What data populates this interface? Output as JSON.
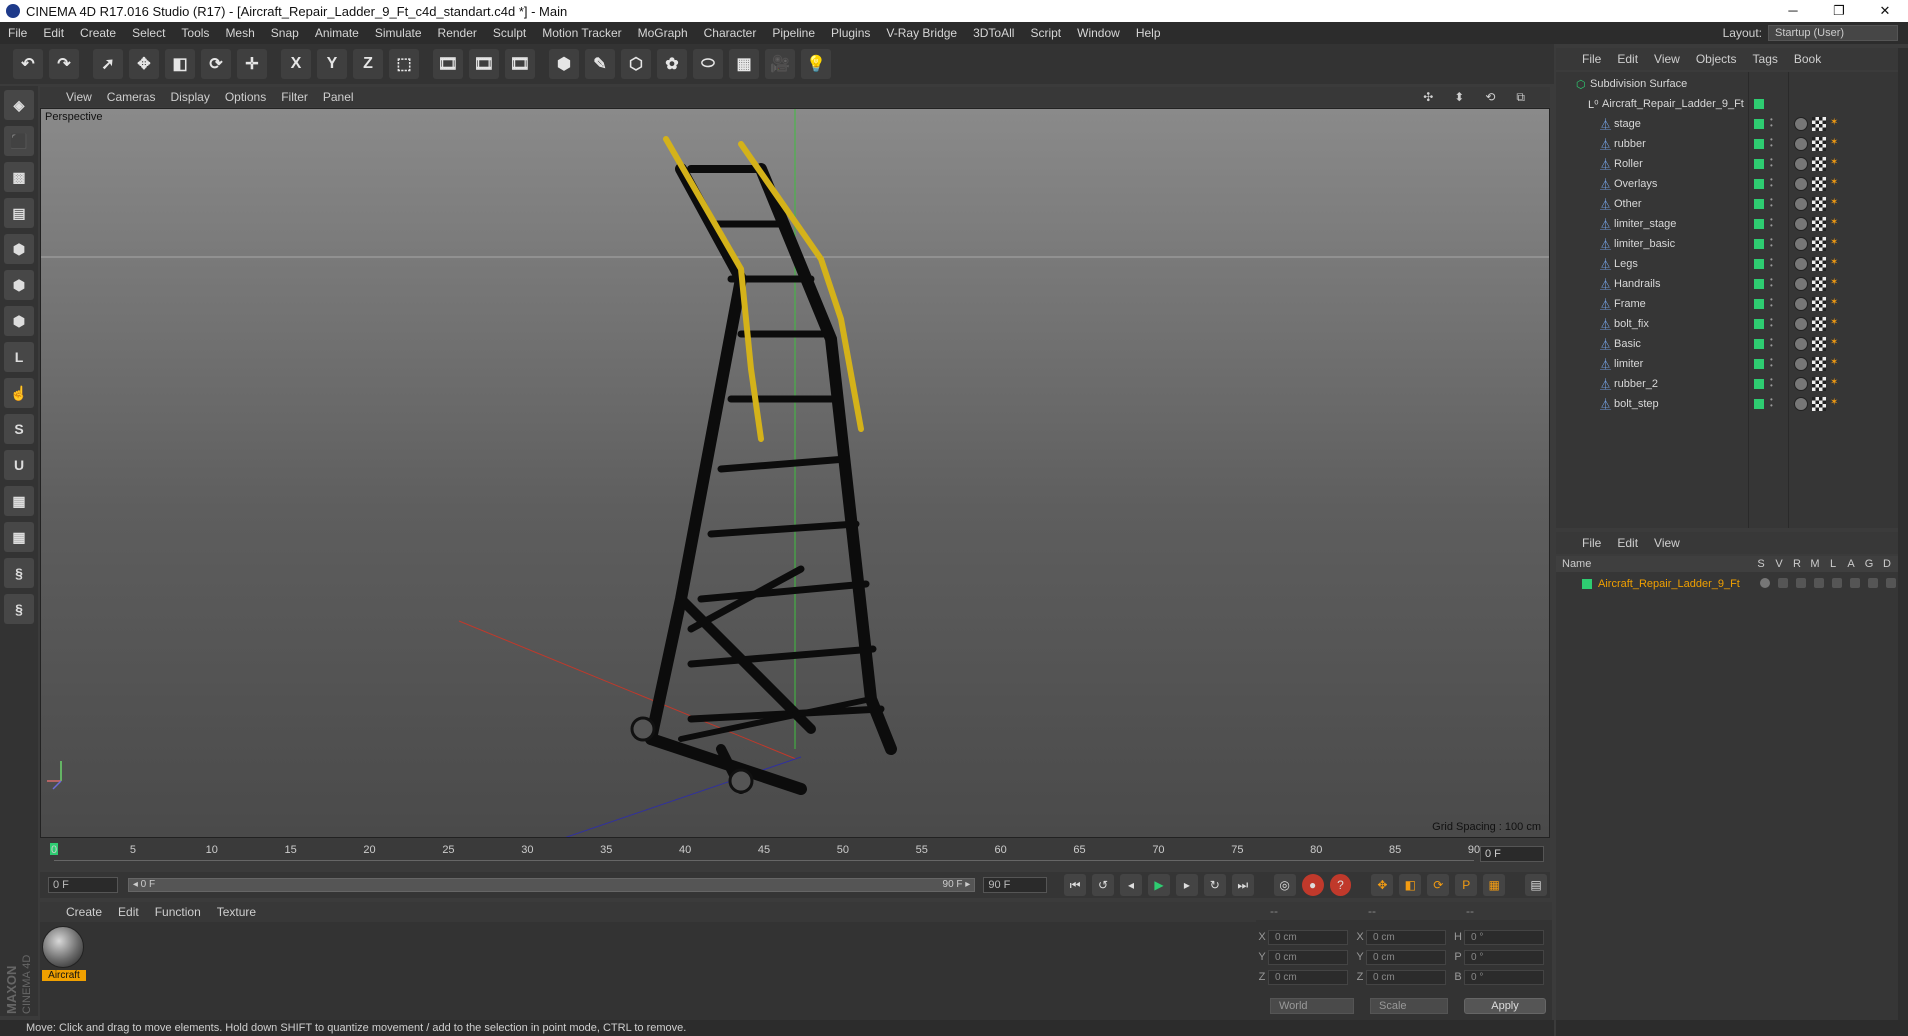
{
  "window": {
    "title": "CINEMA 4D R17.016 Studio (R17) - [Aircraft_Repair_Ladder_9_Ft_c4d_standart.c4d *] - Main",
    "controls": [
      "─",
      "❐",
      "✕"
    ]
  },
  "menubar": {
    "items": [
      "File",
      "Edit",
      "Create",
      "Select",
      "Tools",
      "Mesh",
      "Snap",
      "Animate",
      "Simulate",
      "Render",
      "Sculpt",
      "Motion Tracker",
      "MoGraph",
      "Character",
      "Pipeline",
      "Plugins",
      "V-Ray Bridge",
      "3DToAll",
      "Script",
      "Window",
      "Help"
    ],
    "layout_label": "Layout:",
    "layout_value": "Startup (User)"
  },
  "toolbar": {
    "buttons": [
      {
        "name": "undo-icon",
        "glyph": "↶"
      },
      {
        "name": "redo-icon",
        "glyph": "↷"
      },
      {
        "name": "select-icon",
        "glyph": "➚"
      },
      {
        "name": "move-icon",
        "glyph": "✥"
      },
      {
        "name": "scale-icon",
        "glyph": "◧"
      },
      {
        "name": "rotate-icon",
        "glyph": "⟳"
      },
      {
        "name": "transform-icon",
        "glyph": "✛"
      },
      {
        "name": "x-axis-icon",
        "glyph": "X"
      },
      {
        "name": "y-axis-icon",
        "glyph": "Y"
      },
      {
        "name": "z-axis-icon",
        "glyph": "Z"
      },
      {
        "name": "coordinate-icon",
        "glyph": "⬚"
      },
      {
        "name": "render-view-icon",
        "glyph": "🎞"
      },
      {
        "name": "render-picture-icon",
        "glyph": "🎞"
      },
      {
        "name": "render-settings-icon",
        "glyph": "🎞"
      },
      {
        "name": "cube-icon",
        "glyph": "⬢"
      },
      {
        "name": "pen-icon",
        "glyph": "✎"
      },
      {
        "name": "subdivision-icon",
        "glyph": "⬡"
      },
      {
        "name": "mograph-icon",
        "glyph": "✿"
      },
      {
        "name": "deformer-icon",
        "glyph": "⬭"
      },
      {
        "name": "floor-icon",
        "glyph": "▦"
      },
      {
        "name": "camera-icon",
        "glyph": "🎥"
      },
      {
        "name": "light-icon",
        "glyph": "💡"
      }
    ]
  },
  "left_toolbar": {
    "buttons": [
      {
        "name": "make-editable-icon",
        "glyph": "◈"
      },
      {
        "name": "model-mode-icon",
        "glyph": "⬛"
      },
      {
        "name": "texture-mode-icon",
        "glyph": "▩"
      },
      {
        "name": "workplane-icon",
        "glyph": "▤"
      },
      {
        "name": "points-mode-icon",
        "glyph": "⬢"
      },
      {
        "name": "edges-mode-icon",
        "glyph": "⬢"
      },
      {
        "name": "polygons-mode-icon",
        "glyph": "⬢"
      },
      {
        "name": "axis-mode-icon",
        "glyph": "L"
      },
      {
        "name": "tweak-mode-icon",
        "glyph": "☝"
      },
      {
        "name": "snap-s-icon",
        "glyph": "S"
      },
      {
        "name": "magnet-icon",
        "glyph": "U"
      },
      {
        "name": "sculpt-grid-icon",
        "glyph": "▦"
      },
      {
        "name": "sculpt-lock-icon",
        "glyph": "▦"
      },
      {
        "name": "python-icon",
        "glyph": "§"
      },
      {
        "name": "python-2-icon",
        "glyph": "§"
      }
    ]
  },
  "viewport": {
    "menu": [
      "View",
      "Cameras",
      "Display",
      "Options",
      "Filter",
      "Panel"
    ],
    "nav_icons": [
      "✣",
      "⬍",
      "⟲",
      "⧉"
    ],
    "label": "Perspective",
    "grid_spacing": "Grid Spacing : 100 cm"
  },
  "timeline": {
    "ticks": [
      "0",
      "5",
      "10",
      "15",
      "20",
      "25",
      "30",
      "35",
      "40",
      "45",
      "50",
      "55",
      "60",
      "65",
      "70",
      "75",
      "80",
      "85",
      "90"
    ],
    "current_frame": "0 F"
  },
  "playbar": {
    "start_field": "0 F",
    "range_start": "◂ 0 F",
    "range_end": "90 F ▸",
    "end_field": "90 F",
    "buttons": [
      {
        "name": "go-start-icon",
        "glyph": "⏮"
      },
      {
        "name": "prev-key-icon",
        "glyph": "↺"
      },
      {
        "name": "prev-frame-icon",
        "glyph": "◂"
      },
      {
        "name": "play-icon",
        "glyph": "▶"
      },
      {
        "name": "next-frame-icon",
        "glyph": "▸"
      },
      {
        "name": "next-key-icon",
        "glyph": "↻"
      },
      {
        "name": "go-end-icon",
        "glyph": "⏭"
      },
      {
        "name": "record-icon",
        "glyph": "◎"
      },
      {
        "name": "autokey-icon",
        "glyph": "●"
      },
      {
        "name": "keyframe-help-icon",
        "glyph": "?"
      },
      {
        "name": "key-move-icon",
        "glyph": "✥"
      },
      {
        "name": "key-scale-icon",
        "glyph": "◧"
      },
      {
        "name": "key-rotate-icon",
        "glyph": "⟳"
      },
      {
        "name": "key-param-icon",
        "glyph": "P"
      },
      {
        "name": "key-pla-icon",
        "glyph": "▦"
      },
      {
        "name": "timeline-window-icon",
        "glyph": "▤"
      }
    ]
  },
  "material_manager": {
    "menu": [
      "Create",
      "Edit",
      "Function",
      "Texture"
    ],
    "materials": [
      {
        "label": "Aircraft"
      }
    ]
  },
  "coordinates": {
    "headers": [
      "--",
      "--",
      "--"
    ],
    "rows": [
      {
        "a1": "X",
        "v1": "0 cm",
        "a2": "X",
        "v2": "0 cm",
        "a3": "H",
        "v3": "0 °"
      },
      {
        "a1": "Y",
        "v1": "0 cm",
        "a2": "Y",
        "v2": "0 cm",
        "a3": "P",
        "v3": "0 °"
      },
      {
        "a1": "Z",
        "v1": "0 cm",
        "a2": "Z",
        "v2": "0 cm",
        "a3": "B",
        "v3": "0 °"
      }
    ],
    "mode": "World",
    "transform": "Scale",
    "apply": "Apply"
  },
  "status": "Move: Click and drag to move elements. Hold down SHIFT to quantize movement / add to the selection in point mode, CTRL to remove.",
  "objects_panel": {
    "menu": [
      "File",
      "Edit",
      "View",
      "Objects",
      "Tags",
      "Book"
    ],
    "root": "Subdivision Surface",
    "group": "Aircraft_Repair_Ladder_9_Ft",
    "children": [
      "stage",
      "rubber",
      "Roller",
      "Overlays",
      "Other",
      "limiter_stage",
      "limiter_basic",
      "Legs",
      "Handrails",
      "Frame",
      "bolt_fix",
      "Basic",
      "limiter",
      "rubber_2",
      "bolt_step"
    ]
  },
  "layers_panel": {
    "menu": [
      "File",
      "Edit",
      "View"
    ],
    "columns": [
      "Name",
      "S",
      "V",
      "R",
      "M",
      "L",
      "A",
      "G",
      "D"
    ],
    "rows": [
      "Aircraft_Repair_Ladder_9_Ft"
    ],
    "accent": "#f0a000"
  }
}
